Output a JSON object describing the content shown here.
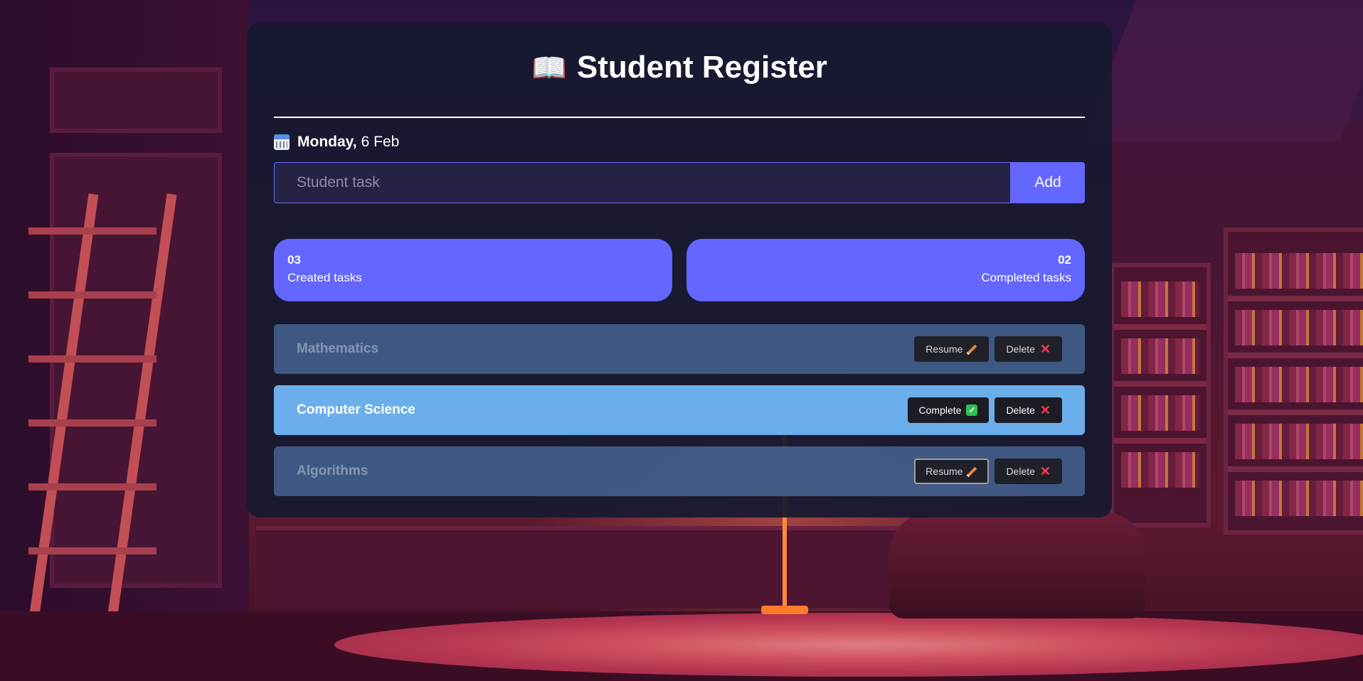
{
  "header": {
    "title": "Student Register",
    "icon": "open-book-icon"
  },
  "date": {
    "weekday": "Monday,",
    "rest": "6 Feb",
    "icon": "calendar-icon"
  },
  "new_task": {
    "placeholder": "Student task",
    "value": "",
    "add_label": "Add"
  },
  "stats": {
    "created": {
      "count": "03",
      "label": "Created tasks"
    },
    "completed": {
      "count": "02",
      "label": "Completed tasks"
    }
  },
  "tasks": [
    {
      "name": "Mathematics",
      "status": "completed",
      "action_label": "Resume",
      "action_icon": "pencil-icon",
      "delete_label": "Delete",
      "delete_icon": "close-icon"
    },
    {
      "name": "Computer Science",
      "status": "pending",
      "action_label": "Complete",
      "action_icon": "check-icon",
      "delete_label": "Delete",
      "delete_icon": "close-icon"
    },
    {
      "name": "Algorithms",
      "status": "completed",
      "action_label": "Resume",
      "action_icon": "pencil-icon",
      "delete_label": "Delete",
      "delete_icon": "close-icon"
    }
  ],
  "colors": {
    "accent": "#6366ff",
    "active_task": "#6aafeb",
    "completed_task": "#5f8cc8",
    "delete_icon": "#ff3b5c",
    "check_icon": "#2fbf52"
  }
}
